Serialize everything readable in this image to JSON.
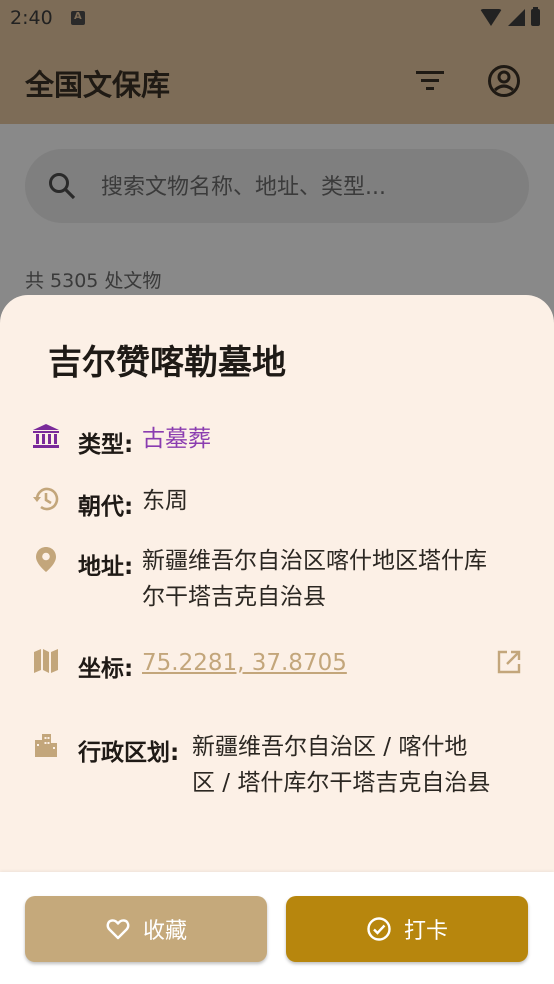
{
  "status_bar": {
    "time": "2:40"
  },
  "app_bar": {
    "title": "全国文保库"
  },
  "search": {
    "placeholder": "搜索文物名称、地址、类型..."
  },
  "list": {
    "count_text": "共 5305 处文物"
  },
  "sheet": {
    "title": "吉尔赞喀勒墓地",
    "type": {
      "label": "类型:",
      "value": "古墓葬"
    },
    "dynasty": {
      "label": "朝代:",
      "value": "东周"
    },
    "address": {
      "label": "地址:",
      "line1": "新疆维吾尔自治区喀什地区塔什库",
      "line2": "尔干塔吉克自治县"
    },
    "coords": {
      "label": "坐标:",
      "value": "75.2281, 37.8705"
    },
    "admin": {
      "label": "行政区划:",
      "line1": "新疆维吾尔自治区 / 喀什地",
      "line2": "区 / 塔什库尔干塔吉克自治县"
    }
  },
  "actions": {
    "favorite": "收藏",
    "checkin": "打卡"
  },
  "colors": {
    "accent_gold": "#b7860d",
    "accent_tan": "#c5a97b",
    "type_purple": "#8a3cb0",
    "icon_tan": "#c3a67b",
    "sheet_bg": "#fcf0e6"
  },
  "icons": {
    "type": "museum-icon",
    "dynasty": "history-icon",
    "address": "location-pin-icon",
    "coords": "map-icon",
    "admin": "city-icon",
    "open": "open-in-new-icon",
    "favorite": "heart-icon",
    "checkin": "check-circle-icon"
  }
}
